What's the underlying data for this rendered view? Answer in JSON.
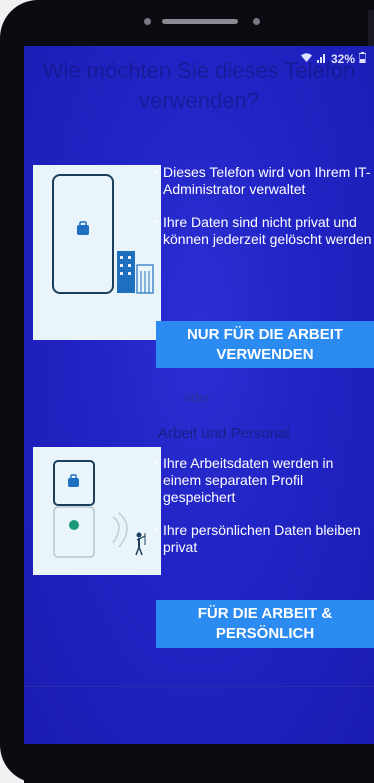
{
  "status_bar": {
    "battery": "32%"
  },
  "header": {
    "title": "Wie möchten Sie dieses Telefon verwenden?"
  },
  "work_only": {
    "bullets": [
      "Dieses Telefon wird von Ihrem IT-Administrator verwaltet",
      "Ihre Daten sind nicht privat und können jederzeit gelöscht werden"
    ],
    "button_label": "NUR FÜR DIE ARBEIT VERWENDEN"
  },
  "separator_text": "oder",
  "work_personal": {
    "title": "Arbeit und Personal",
    "bullets": [
      "Ihre Arbeitsdaten werden in einem separaten Profil gespeichert",
      "Ihre persönlichen Daten bleiben privat"
    ],
    "button_label": "FÜR DIE ARBEIT & PERSÖNLICH"
  },
  "colors": {
    "screen_bg": "#2124c4",
    "button_bg": "#2c8bf0",
    "card_bg": "#e9f4fb"
  }
}
